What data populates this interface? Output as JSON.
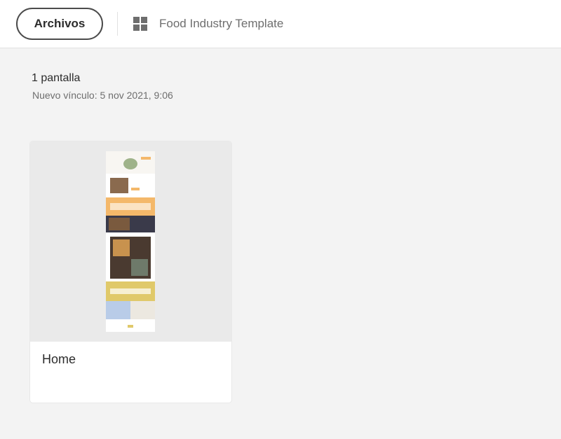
{
  "header": {
    "files_button_label": "Archivos",
    "project_title": "Food Industry Template",
    "view_icon": "grid-icon"
  },
  "summary": {
    "screen_count": "1 pantalla",
    "link_info": "Nuevo vínculo: 5 nov 2021, 9:06"
  },
  "screens": [
    {
      "label": "Home",
      "thumbnail": "home-page-thumbnail"
    }
  ],
  "colors": {
    "background": "#f3f3f3",
    "header": "#ffffff",
    "thumbnail_bg": "#eaeaea",
    "accent_orange": "#f4b86a",
    "accent_dark": "#3a3a4a",
    "accent_yellow": "#e0c96a",
    "accent_blue": "#b9cce8"
  }
}
